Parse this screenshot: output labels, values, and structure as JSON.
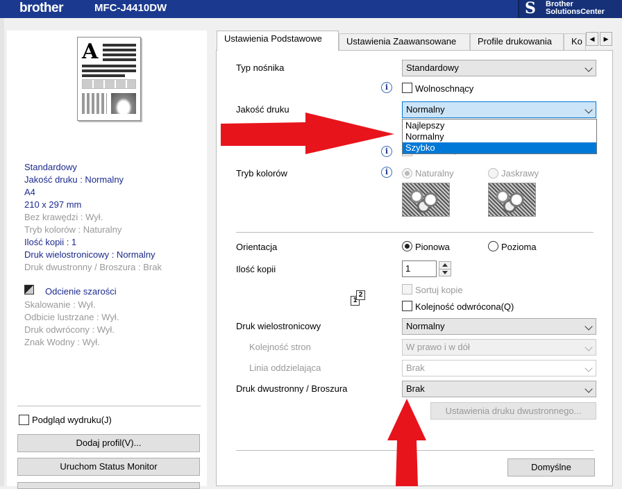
{
  "window": {
    "brand": "brother",
    "model": "MFC-J4410DW",
    "solutions_center_line1": "Brother",
    "solutions_center_line2": "SolutionsCenter"
  },
  "summary": {
    "lines": [
      {
        "text": "Standardowy",
        "style": "blue"
      },
      {
        "text": "Jakość druku : Normalny",
        "style": "blue"
      },
      {
        "text": "A4",
        "style": "blue"
      },
      {
        "text": "210 x 297 mm",
        "style": "blue"
      },
      {
        "text": "Bez krawędzi : Wył.",
        "style": "gray"
      },
      {
        "text": "Tryb kolorów : Naturalny",
        "style": "gray"
      },
      {
        "text": "Ilość kopii  : 1",
        "style": "blue"
      },
      {
        "text": "Druk wielostronicowy  : Normalny",
        "style": "blue"
      },
      {
        "text": "Druk dwustronny / Broszura : Brak",
        "style": "gray"
      }
    ],
    "grayscale_label": "Odcienie szarości",
    "lines2": [
      "Skalowanie : Wył.",
      "Odbicie lustrzane  : Wył.",
      "Druk odwrócony  : Wył.",
      "Znak Wodny : Wył."
    ]
  },
  "left_controls": {
    "preview_checkbox": "Podgląd wydruku(J)",
    "add_profile_button": "Dodaj profil(V)...",
    "status_monitor_button": "Uruchom Status Monitor"
  },
  "tabs": [
    {
      "label": "Ustawienia Podstawowe",
      "active": true
    },
    {
      "label": "Ustawienia Zaawansowane",
      "active": false
    },
    {
      "label": "Profile drukowania",
      "active": false
    },
    {
      "label": "Ko",
      "active": false
    }
  ],
  "basic": {
    "media_type_label": "Typ nośnika",
    "media_type_value": "Standardowy",
    "slow_drying_label": "Wolnoschnący",
    "print_quality_label": "Jakość druku",
    "print_quality_value": "Normalny",
    "print_quality_options": [
      "Najlepszy",
      "Normalny",
      "Szybko"
    ],
    "print_quality_highlighted": "Szybko",
    "borderless_label_partial": "Bez krawędzi",
    "color_mode_label": "Tryb kolorów",
    "color_natural": "Naturalny",
    "color_vivid": "Jaskrawy",
    "orientation_label": "Orientacja",
    "portrait": "Pionowa",
    "landscape": "Pozioma",
    "copies_label": "Ilość kopii",
    "copies_value": "1",
    "collate_label": "Sortuj kopie",
    "reverse_order_label": "Kolejność odwrócona(Q)",
    "multi_page_label": "Druk wielostronicowy",
    "multi_page_value": "Normalny",
    "page_order_label": "Kolejność stron",
    "page_order_value": "W prawo i w dół",
    "border_line_label": "Linia oddzielająca",
    "border_line_value": "Brak",
    "duplex_label": "Druk dwustronny / Broszura",
    "duplex_value": "Brak",
    "duplex_settings_button": "Ustawienia druku dwustronnego...",
    "default_button": "Domyślne"
  },
  "copy_icon_digits": [
    "1",
    "2"
  ],
  "colors": {
    "titlebar": "#1b3a8f",
    "summary_blue": "#1b2a8c",
    "highlight": "#0078d7",
    "annotation_arrow": "#e8141b"
  }
}
